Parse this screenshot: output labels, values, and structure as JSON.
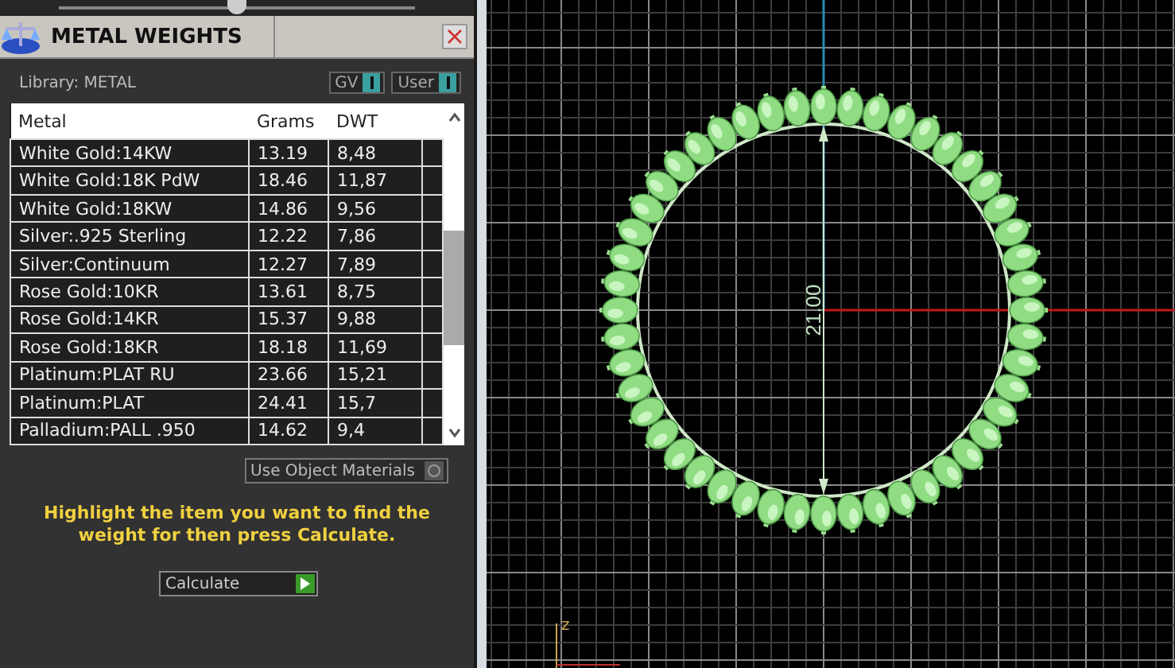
{
  "slider": {
    "level": 0.5
  },
  "panel": {
    "title": "METAL WEIGHTS",
    "library_label": "Library: METAL",
    "toggles": [
      {
        "label": "GV",
        "on": true
      },
      {
        "label": "User",
        "on": true
      }
    ],
    "table": {
      "columns": [
        "Metal",
        "Grams",
        "DWT"
      ],
      "rows": [
        [
          "White Gold:14KW",
          "13.19",
          "8,48"
        ],
        [
          "White Gold:18K PdW",
          "18.46",
          "11,87"
        ],
        [
          "White Gold:18KW",
          "14.86",
          "9,56"
        ],
        [
          "Silver:.925 Sterling",
          "12.22",
          "7,86"
        ],
        [
          "Silver:Continuum",
          "12.27",
          "7,89"
        ],
        [
          "Rose Gold:10KR",
          "13.61",
          "8,75"
        ],
        [
          "Rose Gold:14KR",
          "15.37",
          "9,88"
        ],
        [
          "Rose Gold:18KR",
          "18.18",
          "11,69"
        ],
        [
          "Platinum:PLAT RU",
          "23.66",
          "15,21"
        ],
        [
          "Platinum:PLAT",
          "24.41",
          "15,7"
        ],
        [
          "Palladium:PALL .950",
          "14.62",
          "9,4"
        ]
      ]
    },
    "use_object_materials": {
      "label": "Use Object Materials",
      "on": false
    },
    "hint": "Highlight the item you want to find the weight for then press Calculate.",
    "action": {
      "value": "Calculate"
    }
  },
  "viewport": {
    "dimension": "21.00",
    "axis_label": "z"
  }
}
